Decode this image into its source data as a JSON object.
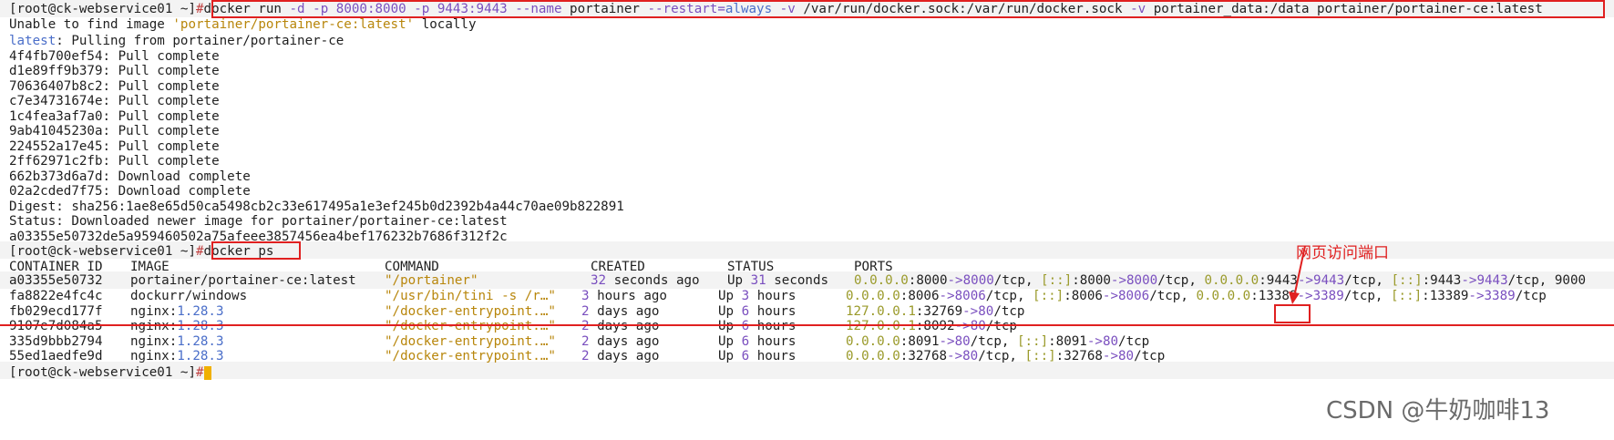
{
  "terminal": {
    "prompt_user": "[root@ck-webservice01 ~]",
    "prompt_hash": "#",
    "run_cmd": {
      "docker": "docker run ",
      "d": "-d",
      "p1": " -p ",
      "p1v": "8000:8000",
      "p2": " -p ",
      "p2v": "9443:9443",
      "name_flag": " --name ",
      "name": "portainer ",
      "restart_flag": "--restart=",
      "restart_val": "always",
      "v1_flag": " -v ",
      "v1": "/var/run/docker.sock:/var/run/docker.sock ",
      "v2_flag": "-v ",
      "v2": "portainer_data:/data portainer/portainer-ce:latest"
    },
    "out": {
      "unable": "Unable to find image ",
      "unable_img": "'portainer/portainer-ce:latest'",
      "unable_tail": " locally",
      "latest": "latest",
      "pulling": ": Pulling from portainer/portainer-ce",
      "layers": [
        {
          "id": "4f4fb700ef54",
          "status": ": Pull complete"
        },
        {
          "id": "d1e89ff9b379",
          "status": ": Pull complete"
        },
        {
          "id": "70636407b8c2",
          "status": ": Pull complete"
        },
        {
          "id": "c7e34731674e",
          "status": ": Pull complete"
        },
        {
          "id": "1c4fea3af7a0",
          "status": ": Pull complete"
        },
        {
          "id": "9ab41045230a",
          "status": ": Pull complete"
        },
        {
          "id": "224552a17e45",
          "status": ": Pull complete"
        },
        {
          "id": "2ff62971c2fb",
          "status": ": Pull complete"
        },
        {
          "id": "662b373d6a7d",
          "status": ": Download complete"
        },
        {
          "id": "02a2cded7f75",
          "status": ": Download complete"
        }
      ],
      "digest": "Digest: sha256:1ae8e65d50ca5498cb2c33e617495a1e3ef245b0d2392b4a44c70ae09b822891",
      "status": "Status: Downloaded newer image for portainer/portainer-ce:latest",
      "container_hash": "a03355e50732de5a959460502a75afeee3857456ea4bef176232b7686f312f2c"
    },
    "ps_cmd": "docker ps",
    "ps_headers": {
      "id": "CONTAINER ID",
      "image": "IMAGE",
      "command": "COMMAND",
      "created": "CREATED",
      "status": "STATUS",
      "ports": "PORTS"
    },
    "final_prompt_user": "[root@ck-webservice01 ~]",
    "final_prompt_hash": "#"
  },
  "annotation": "网页访问端口",
  "watermark": "CSDN @牛奶咖啡13"
}
